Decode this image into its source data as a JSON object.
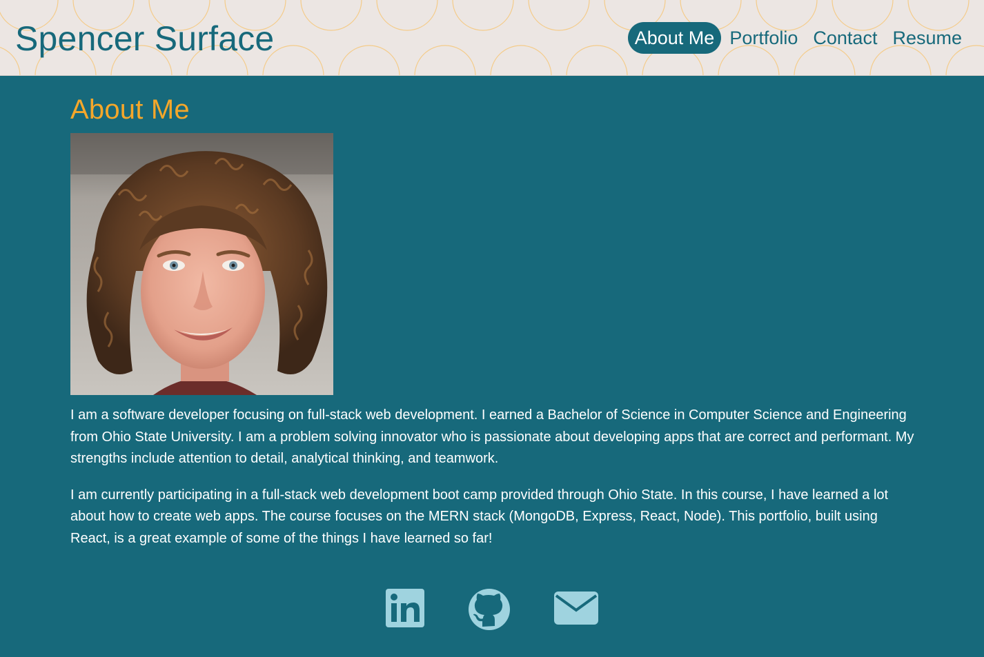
{
  "header": {
    "site_title": "Spencer Surface",
    "nav": [
      {
        "label": "About Me",
        "active": true
      },
      {
        "label": "Portfolio",
        "active": false
      },
      {
        "label": "Contact",
        "active": false
      },
      {
        "label": "Resume",
        "active": false
      }
    ]
  },
  "main": {
    "heading": "About Me",
    "bio_paragraphs": [
      "I am a software developer focusing on full-stack web development. I earned a Bachelor of Science in Computer Science and Engineering from Ohio State University. I am a problem solving innovator who is passionate about developing apps that are correct and performant. My strengths include attention to detail, analytical thinking, and teamwork.",
      "I am currently participating in a full-stack web development boot camp provided through Ohio State. In this course, I have learned a lot about how to create web apps. The course focuses on the MERN stack (MongoDB, Express, React, Node). This portfolio, built using React, is a great example of some of the things I have learned so far!"
    ]
  },
  "social": {
    "icons": [
      "linkedin-icon",
      "github-icon",
      "email-icon"
    ]
  },
  "colors": {
    "primary": "#17697b",
    "accent": "#f5a72a",
    "header_bg": "#ece6e3",
    "icon": "#9fd3df"
  }
}
